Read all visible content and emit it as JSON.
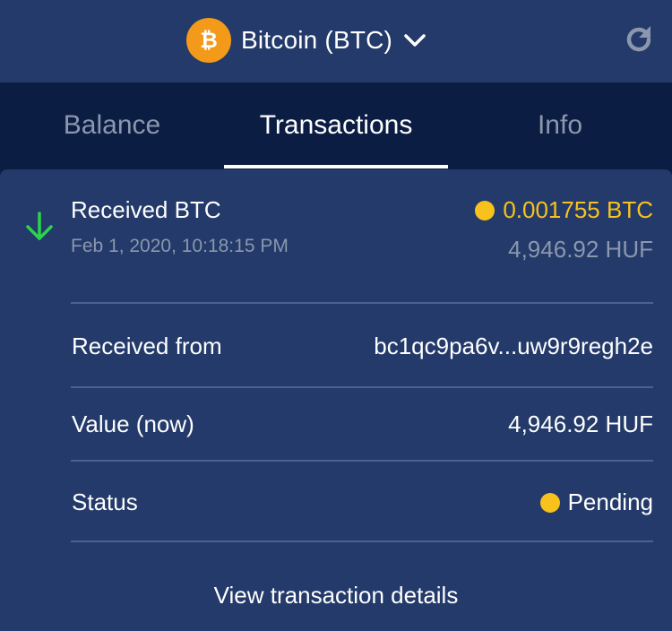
{
  "header": {
    "coin_name": "Bitcoin (BTC)",
    "coin_icon": "bitcoin-logo-icon",
    "dropdown_icon": "chevron-down-icon",
    "refresh_icon": "refresh-icon",
    "brand_color": "#f39a1b"
  },
  "tabs": [
    {
      "label": "Balance",
      "active": false
    },
    {
      "label": "Transactions",
      "active": true
    },
    {
      "label": "Info",
      "active": false
    }
  ],
  "transaction": {
    "direction_icon": "arrow-down-icon",
    "title": "Received BTC",
    "date": "Feb 1, 2020, 10:18:15 PM",
    "amount": "0.001755 BTC",
    "fiat_value": "4,946.92 HUF",
    "details": [
      {
        "label": "Received from",
        "value": "bc1qc9pa6v...uw9r9regh2e"
      },
      {
        "label": "Value (now)",
        "value": "4,946.92 HUF"
      },
      {
        "label": "Status",
        "value": "Pending"
      }
    ],
    "view_details_label": "View transaction details"
  },
  "colors": {
    "pending": "#f7c21c",
    "received_arrow": "#2bd54b",
    "background": "#0c1d44",
    "panel": "#233a6a"
  }
}
